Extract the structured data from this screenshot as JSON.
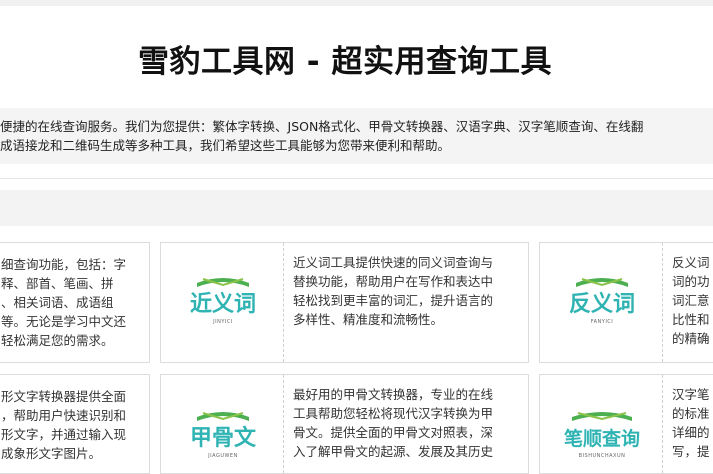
{
  "header": {
    "title": "雪豹工具网 - 超实用查询工具"
  },
  "intro": {
    "line1": "便捷的在线查询服务。我们为您提供：繁体字转换、JSON格式化、甲骨文转换器、汉语字典、汉字笔顺查询、在线翻",
    "line2": "成语接龙和二维码生成等多种工具，我们希望这些工具能够为您带来便利和帮助。"
  },
  "cards_row1": {
    "left_partial": [
      "细查询功能，包括：字",
      "释、部首、笔画、拼",
      "、相关词语、成语组",
      "等。无论是学习中文还",
      "轻松满足您的需求。"
    ],
    "middle": {
      "logo_text": "近义词",
      "logo_sub": "JINYICI",
      "desc": [
        "近义词工具提供快速的同义词查询与",
        "替换功能，帮助用户在写作和表达中",
        "轻松找到更丰富的词汇，提升语言的",
        "多样性、精准度和流畅性。"
      ]
    },
    "right": {
      "logo_text": "反义词",
      "logo_sub": "FANYICI",
      "desc": [
        "反义词",
        "词的功",
        "词汇意",
        "比性和",
        "的精确"
      ]
    }
  },
  "cards_row2": {
    "left_partial": [
      "形文字转换器提供全面",
      "，帮助用户快速识别和",
      "形文字，并通过输入现",
      "成象形文字图片。"
    ],
    "middle": {
      "logo_text": "甲骨文",
      "logo_sub": "JIAGUWEN",
      "desc": [
        "最好用的甲骨文转换器，专业的在线",
        "工具帮助您轻松将现代汉字转换为甲",
        "骨文。提供全面的甲骨文对照表，深",
        "入了解甲骨文的起源、发展及其历史"
      ]
    },
    "right": {
      "logo_text": "笔顺查询",
      "logo_sub": "BISHUNCHAXUN",
      "desc": [
        "汉字笔",
        "的标准",
        "详细的",
        "写，提"
      ]
    }
  },
  "colors": {
    "teal": "#2fb3b3",
    "green": "#4caf50"
  }
}
